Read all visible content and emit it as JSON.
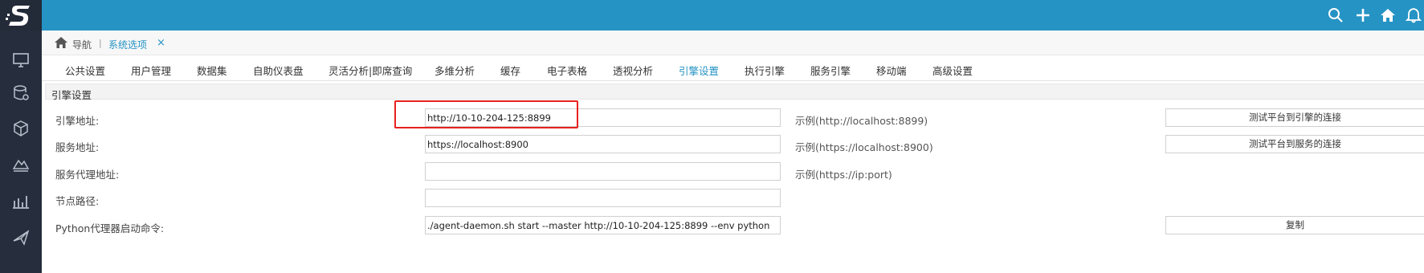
{
  "app": {
    "logo_text": "S",
    "brand_color": "#2593c4",
    "sidebar_color": "#262d3c"
  },
  "sidebar": {
    "items": [
      {
        "icon": "monitor-icon"
      },
      {
        "icon": "database-settings-icon"
      },
      {
        "icon": "cube-icon"
      },
      {
        "icon": "layers-icon"
      },
      {
        "icon": "bar-chart-icon"
      },
      {
        "icon": "send-icon"
      }
    ]
  },
  "header": {
    "icons": [
      "search-icon",
      "plus-icon",
      "home-icon",
      "bell-icon"
    ]
  },
  "breadcrumb": {
    "nav_label": "导航",
    "separator": "|",
    "current": "系统选项",
    "close": "×"
  },
  "tabs": [
    {
      "label": "公共设置"
    },
    {
      "label": "用户管理"
    },
    {
      "label": "数据集"
    },
    {
      "label": "自助仪表盘"
    },
    {
      "label": "灵活分析|即席查询"
    },
    {
      "label": "多维分析"
    },
    {
      "label": "缓存"
    },
    {
      "label": "电子表格"
    },
    {
      "label": "透视分析"
    },
    {
      "label": "引擎设置",
      "active": true
    },
    {
      "label": "执行引擎"
    },
    {
      "label": "服务引擎"
    },
    {
      "label": "移动端"
    },
    {
      "label": "高级设置"
    }
  ],
  "section": {
    "title": "引擎设置",
    "rows": [
      {
        "label": "引擎地址:",
        "value": "http://10-10-204-125:8899",
        "example": "示例(http://localhost:8899)",
        "button": "测试平台到引擎的连接"
      },
      {
        "label": "服务地址:",
        "value": "https://localhost:8900",
        "example": "示例(https://localhost:8900)",
        "button": "测试平台到服务的连接"
      },
      {
        "label": "服务代理地址:",
        "value": "",
        "example": "示例(https://ip:port)",
        "button": ""
      },
      {
        "label": "节点路径:",
        "value": "",
        "example": "",
        "button": ""
      },
      {
        "label": "Python代理器启动命令:",
        "value": "./agent-daemon.sh start --master http://10-10-204-125:8899 --env python",
        "example": "",
        "button": "复制"
      }
    ]
  }
}
